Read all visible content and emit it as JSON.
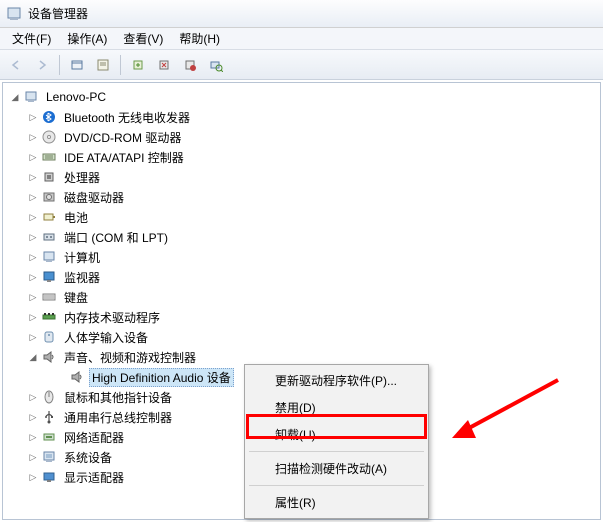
{
  "title": "设备管理器",
  "menus": {
    "file": "文件(F)",
    "action": "操作(A)",
    "view": "查看(V)",
    "help": "帮助(H)"
  },
  "root": "Lenovo-PC",
  "nodes": [
    {
      "id": "bluetooth",
      "label": "Bluetooth 无线电收发器"
    },
    {
      "id": "dvd",
      "label": "DVD/CD-ROM 驱动器"
    },
    {
      "id": "ide",
      "label": "IDE ATA/ATAPI 控制器"
    },
    {
      "id": "cpu",
      "label": "处理器"
    },
    {
      "id": "disk",
      "label": "磁盘驱动器"
    },
    {
      "id": "battery",
      "label": "电池"
    },
    {
      "id": "ports",
      "label": "端口 (COM 和 LPT)"
    },
    {
      "id": "computer",
      "label": "计算机"
    },
    {
      "id": "monitor",
      "label": "监视器"
    },
    {
      "id": "keyboard",
      "label": "键盘"
    },
    {
      "id": "memtech",
      "label": "内存技术驱动程序"
    },
    {
      "id": "hid",
      "label": "人体学输入设备"
    },
    {
      "id": "sound",
      "label": "声音、视频和游戏控制器",
      "expanded": true,
      "children": [
        {
          "id": "hdaudio",
          "label": "High Definition Audio 设备",
          "selected": true
        }
      ]
    },
    {
      "id": "mouse",
      "label": "鼠标和其他指针设备"
    },
    {
      "id": "usb",
      "label": "通用串行总线控制器"
    },
    {
      "id": "network",
      "label": "网络适配器"
    },
    {
      "id": "system",
      "label": "系统设备"
    },
    {
      "id": "display",
      "label": "显示适配器"
    }
  ],
  "context": {
    "update": "更新驱动程序软件(P)...",
    "disable": "禁用(D)",
    "uninstall": "卸载(U)",
    "scan": "扫描检测硬件改动(A)",
    "properties": "属性(R)"
  },
  "icons": {
    "bluetooth": "bt",
    "dvd": "cd",
    "ide": "ide",
    "cpu": "cpu",
    "disk": "disk",
    "battery": "batt",
    "ports": "port",
    "computer": "pc",
    "monitor": "mon",
    "keyboard": "kb",
    "memtech": "mem",
    "hid": "hid",
    "sound": "spk",
    "hdaudio": "spk",
    "mouse": "mouse",
    "usb": "usb",
    "network": "net",
    "system": "sys",
    "display": "disp"
  }
}
